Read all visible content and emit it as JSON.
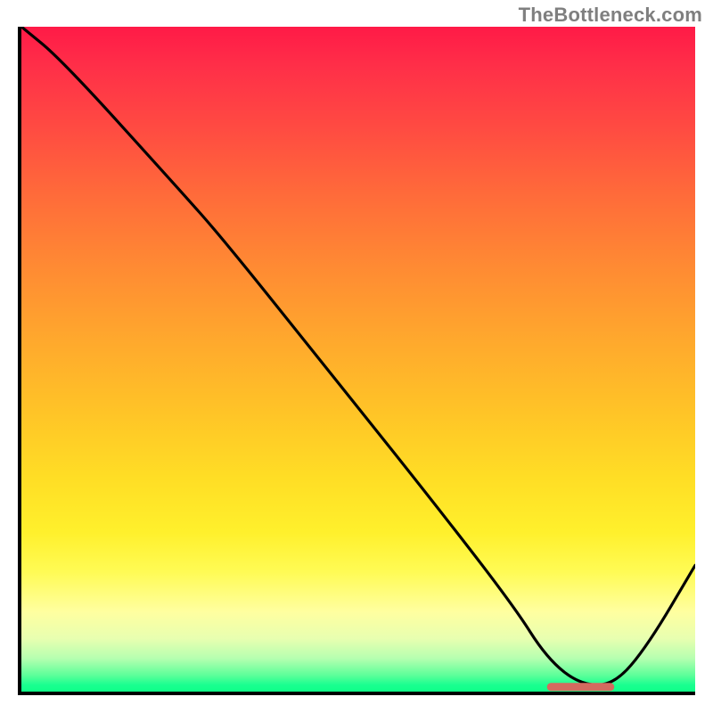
{
  "attribution": "TheBottleneck.com",
  "chart_data": {
    "type": "line",
    "title": "",
    "xlabel": "",
    "ylabel": "",
    "xlim": [
      0,
      100
    ],
    "ylim": [
      0,
      100
    ],
    "x": [
      0,
      6,
      23,
      30,
      45,
      60,
      73,
      78,
      83,
      88,
      93,
      100
    ],
    "values": [
      100,
      95,
      76,
      68,
      49,
      30,
      13,
      5,
      1,
      1,
      7,
      19
    ],
    "marker": {
      "x_range": [
        78,
        88
      ],
      "y": 0.7,
      "color": "#d46a5f"
    },
    "gradient_stops": [
      {
        "pos": 0.0,
        "color": "#ff1a47"
      },
      {
        "pos": 0.15,
        "color": "#ff4a42"
      },
      {
        "pos": 0.36,
        "color": "#ff8a33"
      },
      {
        "pos": 0.58,
        "color": "#ffc427"
      },
      {
        "pos": 0.76,
        "color": "#fff02c"
      },
      {
        "pos": 0.88,
        "color": "#ffffa0"
      },
      {
        "pos": 0.95,
        "color": "#b6ffb0"
      },
      {
        "pos": 1.0,
        "color": "#0fff88"
      }
    ]
  }
}
